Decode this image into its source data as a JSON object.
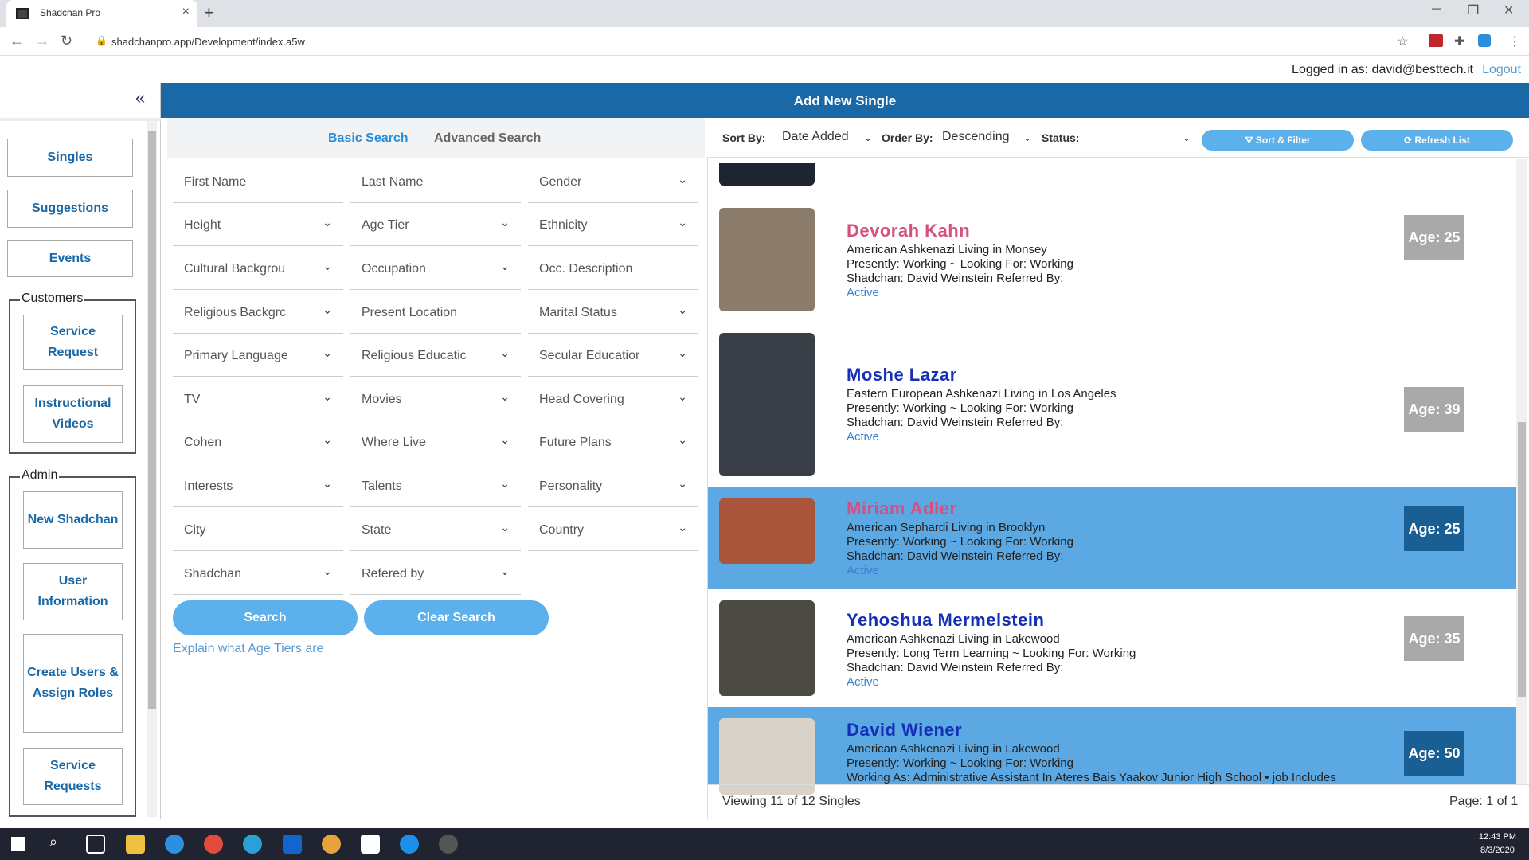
{
  "browser": {
    "tab_title": "Shadchan Pro",
    "tab_close": "×",
    "new_tab": "+",
    "url": "shadchanpro.app/Development/index.a5w",
    "back": "←",
    "forward": "→",
    "reload": "↻",
    "minimize": "─",
    "restore": "❐",
    "close": "✕"
  },
  "header": {
    "logged_in": "Logged in as: david@besttech.it",
    "logout": "Logout",
    "title": "Add New Single",
    "collapse": "«"
  },
  "sidebar": {
    "buttons": [
      "Singles",
      "Suggestions",
      "Events"
    ],
    "customers_label": "Customers",
    "customers": [
      "Service Request",
      "Instructional Videos"
    ],
    "admin_label": "Admin",
    "admin": [
      "New Shadchan",
      "User Information",
      "Create Users & Assign Roles",
      "Service Requests"
    ]
  },
  "search": {
    "tabs": [
      "Basic Search",
      "Advanced Search"
    ],
    "fields": [
      {
        "label": "First Name",
        "dropdown": false
      },
      {
        "label": "Last Name",
        "dropdown": false
      },
      {
        "label": "Gender",
        "dropdown": true
      },
      {
        "label": "Height",
        "dropdown": true
      },
      {
        "label": "Age Tier",
        "dropdown": true
      },
      {
        "label": "Ethnicity",
        "dropdown": true
      },
      {
        "label": "Cultural Backgrou",
        "dropdown": true
      },
      {
        "label": "Occupation",
        "dropdown": true
      },
      {
        "label": "Occ. Description",
        "dropdown": false
      },
      {
        "label": "Religious Backgrc",
        "dropdown": true
      },
      {
        "label": "Present Location",
        "dropdown": false
      },
      {
        "label": "Marital Status",
        "dropdown": true
      },
      {
        "label": "Primary Language",
        "dropdown": true
      },
      {
        "label": "Religious Educatic",
        "dropdown": true
      },
      {
        "label": "Secular Educatior",
        "dropdown": true
      },
      {
        "label": "TV",
        "dropdown": true
      },
      {
        "label": "Movies",
        "dropdown": true
      },
      {
        "label": "Head Covering",
        "dropdown": true
      },
      {
        "label": "Cohen",
        "dropdown": true
      },
      {
        "label": "Where Live",
        "dropdown": true
      },
      {
        "label": "Future Plans",
        "dropdown": true
      },
      {
        "label": "Interests",
        "dropdown": true
      },
      {
        "label": "Talents",
        "dropdown": true
      },
      {
        "label": "Personality",
        "dropdown": true
      },
      {
        "label": "City",
        "dropdown": false
      },
      {
        "label": "State",
        "dropdown": true
      },
      {
        "label": "Country",
        "dropdown": true
      },
      {
        "label": "Shadchan",
        "dropdown": true
      },
      {
        "label": "Refered by",
        "dropdown": true
      }
    ],
    "search_button": "Search",
    "clear_button": "Clear Search",
    "explain_link": "Explain what Age Tiers are"
  },
  "sortbar": {
    "sort_by_label": "Sort By:",
    "sort_by_value": "Date Added",
    "order_by_label": "Order By:",
    "order_by_value": "Descending",
    "status_label": "Status:",
    "status_value": "",
    "sort_filter_button": "Sort & Filter",
    "refresh_button": "Refresh List"
  },
  "results": [
    {
      "name": "Devorah  Kahn",
      "name_color": "#d6507f",
      "line1": "American  Ashkenazi  Living in Monsey",
      "line2": "Presently: Working  ~ Looking For: Working",
      "line3": "Shadchan: David  Weinstein  Referred By:",
      "status": "Active",
      "age": "Age: 25",
      "selected": false
    },
    {
      "name": "Moshe  Lazar",
      "name_color": "#1530b8",
      "line1": "Eastern European  Ashkenazi  Living in Los Angeles",
      "line2": "Presently: Working  ~ Looking For: Working",
      "line3": "Shadchan: David  Weinstein  Referred By:",
      "status": "Active",
      "age": "Age: 39",
      "selected": false
    },
    {
      "name": "Miriam  Adler",
      "name_color": "#d6507f",
      "line1": "American  Sephardi  Living in Brooklyn",
      "line2": "Presently: Working  ~ Looking For: Working",
      "line3": "Shadchan: David  Weinstein  Referred By:",
      "status": "Active",
      "age": "Age: 25",
      "selected": true
    },
    {
      "name": "Yehoshua  Mermelstein",
      "name_color": "#1530b8",
      "line1": "American  Ashkenazi  Living in Lakewood",
      "line2": "Presently: Long Term Learning  ~ Looking For: Working",
      "line3": "Shadchan: David  Weinstein  Referred By:",
      "status": "Active",
      "age": "Age: 35",
      "selected": false
    },
    {
      "name": "David  Wiener",
      "name_color": "#1530b8",
      "line1": "American  Ashkenazi  Living in Lakewood",
      "line2": "Presently: Working  ~ Looking For: Working",
      "line3": "Working As: Administrative Assistant In Ateres Bais Yaakov Junior High School • job Includes",
      "status": "",
      "age": "Age: 50",
      "selected": true
    }
  ],
  "footer": {
    "viewing": "Viewing 11 of 12 Singles",
    "page": "Page: 1 of 1"
  },
  "taskbar": {
    "time": "12:43 PM",
    "date": "8/3/2020"
  },
  "colors": {
    "brand_blue": "#1a68a6",
    "accent_light_blue": "#5cb0ec",
    "selected_row": "#5ba8e3",
    "female_name": "#d6507f",
    "male_name": "#1530b8"
  }
}
